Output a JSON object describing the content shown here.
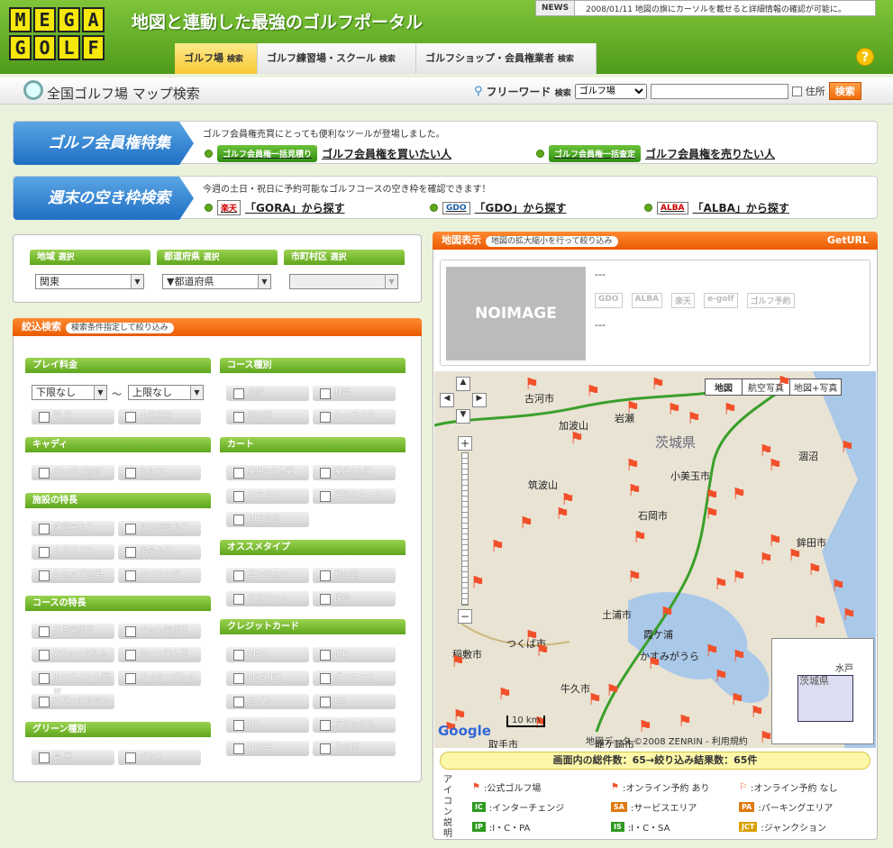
{
  "header": {
    "logo_rows": [
      "MEGA",
      "GOLF"
    ],
    "tagline": "地図と連動した最強のゴルフポータル",
    "news_label": "NEWS",
    "news_text": "2008/01/11 地図の旗にカーソルを載せると詳細情報の確認が可能に。",
    "nav": [
      {
        "label": "ゴルフ場",
        "sub": "検索"
      },
      {
        "label": "ゴルフ練習場・スクール",
        "sub": "検索"
      },
      {
        "label": "ゴルフショップ・会員権業者",
        "sub": "検索"
      }
    ],
    "help": "?"
  },
  "subbar": {
    "title": "全国ゴルフ場 マップ検索",
    "freeword_label": "フリーワード",
    "freeword_sub": "検索",
    "select_value": "ゴルフ場",
    "address_label": "住所",
    "search_button": "検索"
  },
  "banner1": {
    "label": "ゴルフ会員権特集",
    "desc": "ゴルフ会員権売買にとっても便利なツールが登場しました。",
    "btn1": "ゴルフ会員権一括見積り",
    "link1": "ゴルフ会員権を買いたい人",
    "btn2": "ゴルフ会員権一括査定",
    "link2": "ゴルフ会員権を売りたい人"
  },
  "banner2": {
    "label": "週末の空き枠検索",
    "desc": "今週の土日・祝日に予約可能なゴルフコースの空き枠を確認できます！",
    "links": [
      {
        "logo": "楽天",
        "text": "「GORA」から探す"
      },
      {
        "logo": "GDO",
        "text": "「GDO」から探す"
      },
      {
        "logo": "ALBA",
        "text": "「ALBA」から探す"
      }
    ]
  },
  "region": {
    "area_label": "地域",
    "area_sub": "選択",
    "area_value": "関東",
    "pref_label": "都道府県",
    "pref_sub": "選択",
    "pref_value": "▼都道府県",
    "city_label": "市町村区",
    "city_sub": "選択",
    "city_value": ""
  },
  "filter": {
    "title": "絞込検索",
    "pill": "検索条件指定して絞り込み",
    "price_label": "プレイ料金",
    "price_min": "下限なし",
    "price_tilde": "〜",
    "price_max": "上限なし",
    "price_opts": [
      "平 日",
      "土日祝日"
    ],
    "caddie_label": "キャディ",
    "caddie_opts": [
      "キャディ付き",
      "セルフ"
    ],
    "facility_label": "施設の特長",
    "facility_opts": [
      "練習場あり",
      "宿泊施設あり",
      "クラブバス",
      "温泉あり",
      "ショップ充実",
      "バイキング"
    ],
    "course_feat_label": "コースの特長",
    "course_feat_opts": [
      "子供同伴可",
      "ペット同伴可",
      "7チャード以上",
      "カート乗入可",
      "トーナメント開催",
      "ナイタープレイ",
      "ハザード少ない"
    ],
    "green_label": "グリーン種別",
    "green_opts": [
      "高 麗",
      "ベント"
    ],
    "course_type_label": "コース種別",
    "course_type_opts": [
      "丘陵",
      "林間",
      "河川敷",
      "シーサイド"
    ],
    "cart_label": "カート",
    "cart_opts": [
      "乗用4·5人乗",
      "乗用2人乗",
      "リモコン",
      "手引きカート",
      "GPS付き"
    ],
    "recommend_label": "オススメタイプ",
    "recommend_opts": [
      "エンジョイ",
      "初心者",
      "アスリート",
      "接待"
    ],
    "card_label": "クレジットカード",
    "card_opts": [
      "VISA",
      "JCB",
      "MASTER",
      "ダイナース",
      "セゾン",
      "UC",
      "DC",
      "アメックス",
      "NICOS",
      "その他"
    ]
  },
  "map": {
    "title": "地図表示",
    "pill": "地図の拡大縮小を行って絞り込み",
    "geturl": "GetURL",
    "noimage": "NOIMAGE",
    "info_line1": "---",
    "info_line2": "---",
    "partner_logos": [
      "GDO",
      "ALBA",
      "楽天",
      "e-golf",
      "ゴルフ予約"
    ],
    "map_types": [
      "地図",
      "航空写真",
      "地図+写真"
    ],
    "places": [
      "古河市",
      "加波山",
      "岩瀬",
      "茨城県",
      "涸沼",
      "小美玉市",
      "筑波山",
      "石岡市",
      "鉾田市",
      "土浦市",
      "霞ケ浦",
      "かすみがうら",
      "つくば市",
      "牛久市",
      "取手市",
      "龍ケ崎市",
      "稲敷市",
      "水戸",
      "茨城県"
    ],
    "scale": "10 km",
    "copyright": "地図データ ©2008 ZENRIN - 利用規約",
    "google": "Google",
    "status": "画面内の総件数：65→絞り込み結果数：65件",
    "legend_title": "アイコン説明",
    "legend": [
      {
        "label": ":公式ゴルフ場"
      },
      {
        "label": ":オンライン予約 あり"
      },
      {
        "label": ":オンライン予約 なし"
      },
      {
        "code": "IC",
        "label": ":インターチェンジ"
      },
      {
        "code": "SA",
        "label": ":サービスエリア"
      },
      {
        "code": "PA",
        "label": ":パーキングエリア"
      },
      {
        "code": "IP",
        "label": ":I・C・PA"
      },
      {
        "code": "IS",
        "label": ":I・C・SA"
      },
      {
        "code": "JCT",
        "label": ":ジャンクション"
      }
    ],
    "colors": {
      "ic": "#2d9a1e",
      "sa": "#e07a10",
      "pa": "#e07a10",
      "jct": "#d9a000",
      "flag": "#f2502a",
      "road": "#3aa02a"
    }
  }
}
